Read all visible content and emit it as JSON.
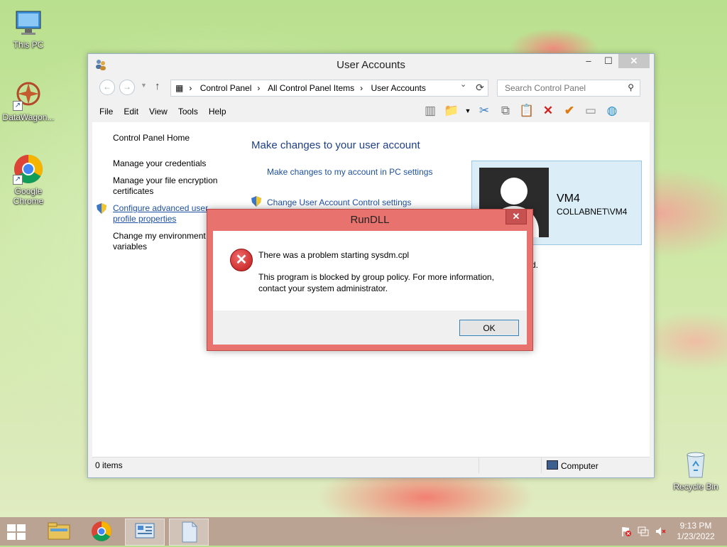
{
  "desktop": {
    "icons": [
      {
        "label": "This PC"
      },
      {
        "label": "DataWagon..."
      },
      {
        "label": "Google Chrome"
      },
      {
        "label": "Recycle Bin"
      }
    ]
  },
  "window": {
    "title": "User Accounts",
    "controls": {
      "minimize": "–",
      "maximize": "☐",
      "close": "✕"
    },
    "address": {
      "crumbs": [
        "Control Panel",
        "All Control Panel Items",
        "User Accounts"
      ],
      "search_placeholder": "Search Control Panel"
    },
    "menu": [
      "File",
      "Edit",
      "View",
      "Tools",
      "Help"
    ],
    "leftnav": {
      "home": "Control Panel Home",
      "credentials": "Manage your credentials",
      "encryption": "Manage your file encryption certificates",
      "advanced": "Configure advanced user profile properties",
      "environment": "Change my environment variables"
    },
    "main": {
      "heading": "Make changes to your user account",
      "link_pc_settings": "Make changes to my account in PC settings",
      "link_uac": "Change User Account Control settings",
      "obscured_fragment": "d."
    },
    "user": {
      "name": "VM4",
      "domain": "COLLABNET\\VM4"
    },
    "status": {
      "items": "0 items",
      "location": "Computer"
    }
  },
  "dialog": {
    "title": "RunDLL",
    "close": "✕",
    "message": "There was a problem starting sysdm.cpl",
    "detail": "This program is blocked by group policy. For more information, contact your system administrator.",
    "ok_label": "OK"
  },
  "taskbar": {
    "clock_time": "9:13 PM",
    "clock_date": "1/23/2022"
  },
  "colors": {
    "link": "#1e50a2",
    "heading": "#1e3f8a",
    "dialog_frame": "#e8726d",
    "user_card": "#dbeef8"
  }
}
